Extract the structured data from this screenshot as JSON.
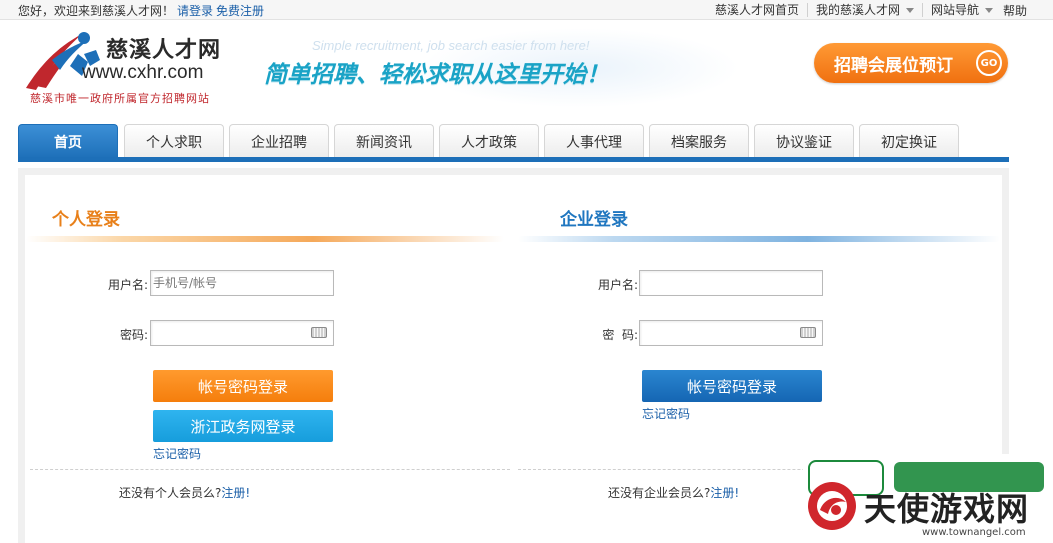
{
  "topbar": {
    "greeting": "您好，欢迎来到慈溪人才网！",
    "login_link": "请登录",
    "register_link": "免费注册",
    "links": [
      {
        "label": "慈溪人才网首页"
      },
      {
        "label": "我的慈溪人才网"
      },
      {
        "label": "网站导航"
      }
    ],
    "help": "帮助"
  },
  "header": {
    "site_name": "慈溪人才网",
    "site_url": "www.cxhr.com",
    "slogan": "慈溪市唯一政府所属官方招聘网站",
    "banner_en": "Simple recruitment, job search easier from here!",
    "banner_cn": "简单招聘、轻松求职从这里开始！",
    "expo_button": "招聘会展位预订",
    "expo_go": "GO"
  },
  "nav": {
    "tabs": [
      {
        "label": "首页",
        "active": true
      },
      {
        "label": "个人求职"
      },
      {
        "label": "企业招聘"
      },
      {
        "label": "新闻资讯"
      },
      {
        "label": "人才政策"
      },
      {
        "label": "人事代理"
      },
      {
        "label": "档案服务"
      },
      {
        "label": "协议鉴证"
      },
      {
        "label": "初定换证"
      }
    ]
  },
  "personal": {
    "title": "个人登录",
    "username_label": "用户名:",
    "username_placeholder": "手机号/帐号",
    "password_label": "密码:",
    "login_button": "帐号密码登录",
    "zj_login_button": "浙江政务网登录",
    "forgot": "忘记密码",
    "register_prompt": "还没有个人会员么?",
    "register_link": "注册!"
  },
  "company": {
    "title": "企业登录",
    "username_label": "用户名:",
    "password_label": "密  码:",
    "login_button": "帐号密码登录",
    "forgot": "忘记密码",
    "register_prompt": "还没有企业会员么?",
    "register_link": "注册!"
  },
  "watermark": {
    "text": "天使游戏网",
    "url": "www.townangel.com"
  },
  "colors": {
    "brand_blue": "#1d6fb8",
    "orange": "#f57e0c",
    "sky": "#169ddc",
    "link": "#1a5fa8"
  }
}
